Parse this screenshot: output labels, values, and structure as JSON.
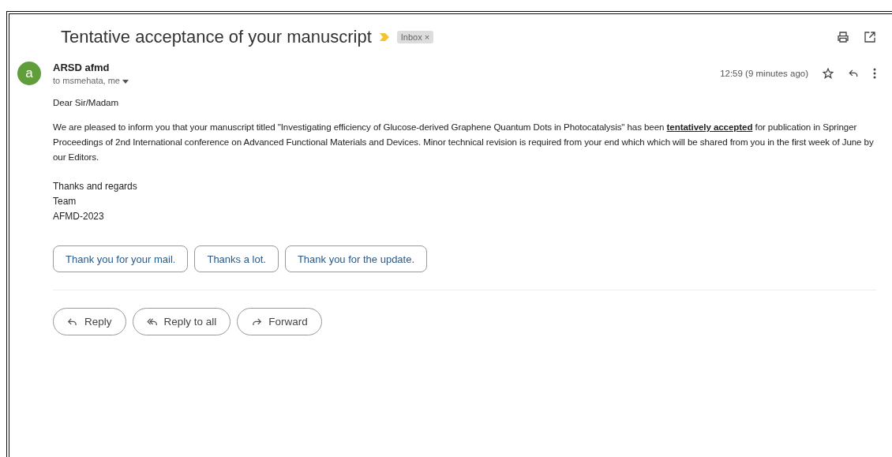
{
  "subject": "Tentative acceptance of your manuscript",
  "label": {
    "text": "Inbox",
    "remove": "×"
  },
  "message": {
    "sender": "ARSD afmd",
    "avatar": "a",
    "recipients": "to msmehata, me",
    "time": "12:59 (9 minutes ago)",
    "body": [
      "Dear Sir/Madam",
      "We are pleased to inform you that your manuscript titled \"Investigating efficiency of Glucose-derived Graphene Quantum Dots in Photocatalysis\" has been **tentatively accepted** for publication in Springer Proceedings of 2nd International conference on Advanced Functional Materials and Devices. Minor technical revision is required from your end which which will be shared from you in the first week of June by our Editors."
    ],
    "signature": [
      "Thanks and regards",
      "Team",
      "AFMD-2023"
    ]
  },
  "smart_replies": [
    "Thank you for your mail.",
    "Thanks a lot.",
    "Thank you for the update."
  ],
  "actions": [
    {
      "kind": "reply",
      "label": "Reply"
    },
    {
      "kind": "reply_all",
      "label": "Reply to all"
    },
    {
      "kind": "forward",
      "label": "Forward"
    }
  ]
}
